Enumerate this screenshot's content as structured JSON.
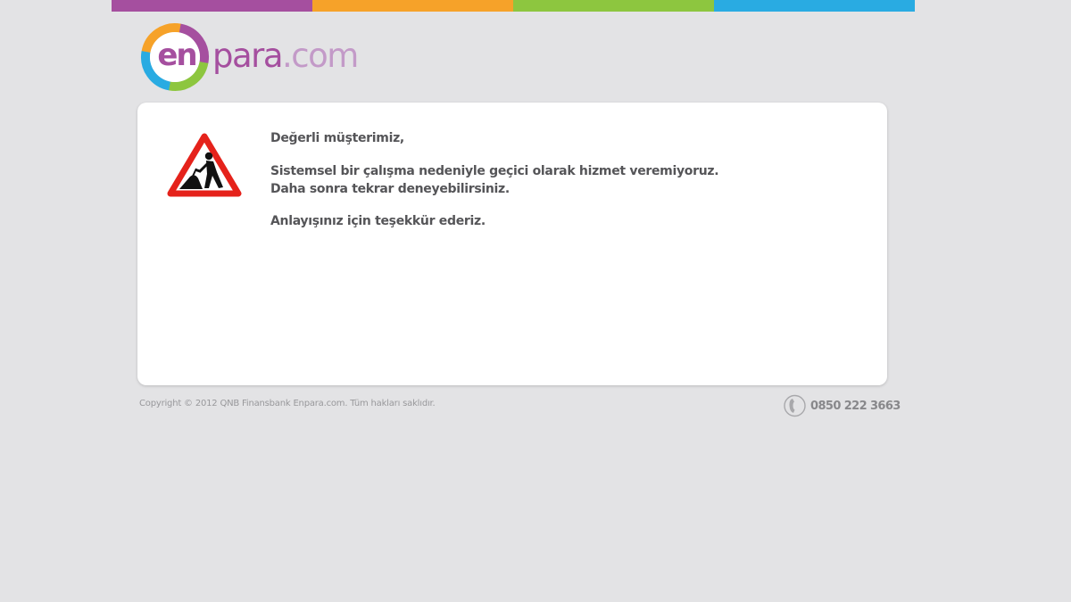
{
  "colors": {
    "stripe": [
      "#a54f9f",
      "#f6a229",
      "#8dc63f",
      "#29abe2"
    ],
    "brand_purple": "#a54f9f",
    "brand_light_purple": "#c39ac8",
    "text": "#555558",
    "footer_text": "#98989b"
  },
  "logo": {
    "en": "en",
    "para": "para",
    "dotcom": ".com"
  },
  "notice": {
    "icon": "road-works-warning-icon",
    "greeting": "Değerli müşterimiz,",
    "line1": "Sistemsel bir çalışma nedeniyle geçici olarak hizmet veremiyoruz.",
    "line2": "Daha sonra tekrar deneyebilirsiniz.",
    "thanks": "Anlayışınız için teşekkür ederiz."
  },
  "footer": {
    "copyright": "Copyright © 2012 QNB Finansbank Enpara.com. Tüm hakları saklıdır.",
    "phone_icon": "phone-icon",
    "phone": "0850 222 3663"
  }
}
